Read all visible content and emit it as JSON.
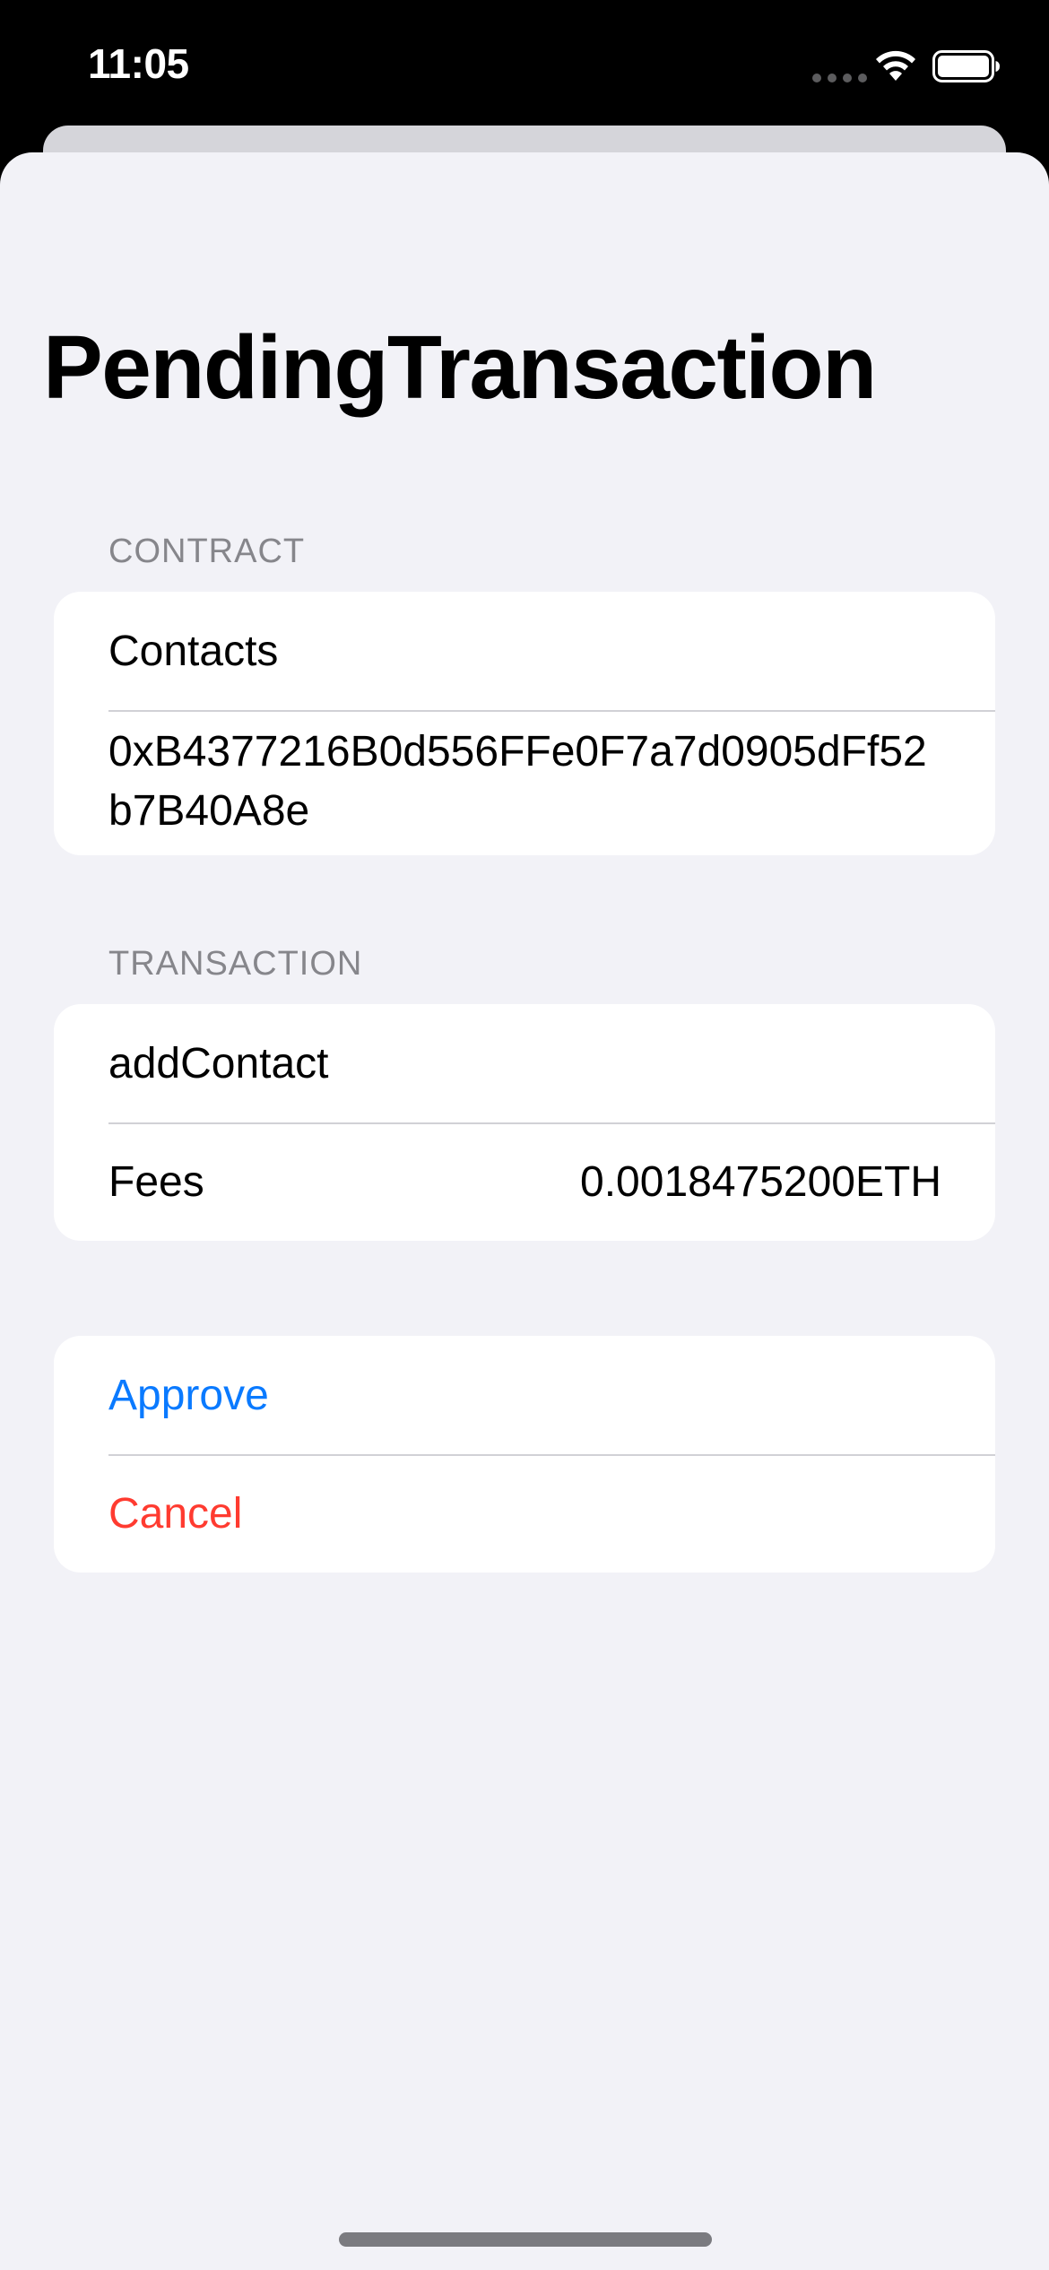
{
  "status_bar": {
    "time": "11:05"
  },
  "title": "PendingTransaction",
  "contract_section": {
    "header": "CONTRACT",
    "name": "Contacts",
    "address": "0xB4377216B0d556FFe0F7a7d0905dFf52b7B40A8e"
  },
  "transaction_section": {
    "header": "TRANSACTION",
    "method": "addContact",
    "fees_label": "Fees",
    "fees_value": "0.0018475200ETH"
  },
  "actions": {
    "approve_label": "Approve",
    "cancel_label": "Cancel"
  },
  "colors": {
    "approve": "#0a7aff",
    "cancel": "#ff3b30",
    "background": "#f2f2f7"
  },
  "icons": [
    "cellular-icon",
    "wifi-icon",
    "battery-icon"
  ]
}
